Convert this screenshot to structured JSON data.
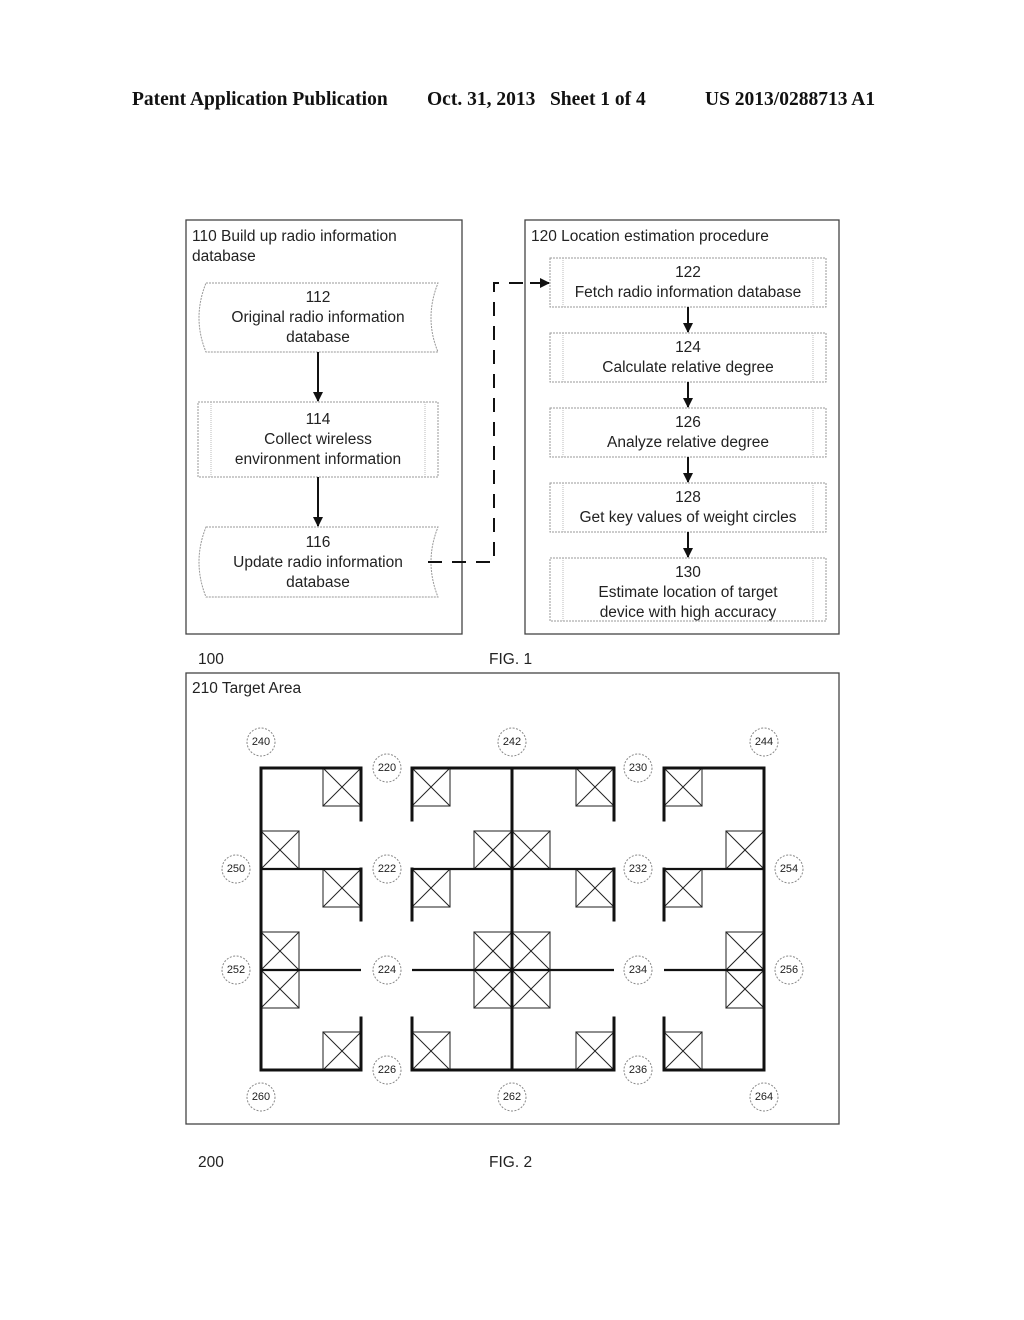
{
  "header": {
    "left": "Patent Application Publication",
    "date_sheet": "Oct. 31, 2013   Sheet 1 of 4",
    "number": "US 2013/0288713 A1"
  },
  "fig1": {
    "ref": "100",
    "caption": "FIG. 1",
    "group110": {
      "title_line1": "110 Build up radio information",
      "title_line2": "database",
      "steps": [
        {
          "num": "112",
          "lines": [
            "Original radio information",
            "database"
          ],
          "shape": "data-store"
        },
        {
          "num": "114",
          "lines": [
            "Collect wireless",
            "environment information"
          ],
          "shape": "process"
        },
        {
          "num": "116",
          "lines": [
            "Update radio information",
            "database"
          ],
          "shape": "data-store"
        }
      ]
    },
    "group120": {
      "title": "120 Location estimation procedure",
      "steps": [
        {
          "num": "122",
          "lines": [
            "Fetch radio information database"
          ]
        },
        {
          "num": "124",
          "lines": [
            "Calculate relative degree"
          ]
        },
        {
          "num": "126",
          "lines": [
            "Analyze relative degree"
          ]
        },
        {
          "num": "128",
          "lines": [
            "Get key values of weight circles"
          ]
        },
        {
          "num": "130",
          "lines": [
            "Estimate location of target",
            "device with high accuracy"
          ]
        }
      ]
    }
  },
  "fig2": {
    "ref": "200",
    "caption": "FIG. 2",
    "area_title": "210 Target Area",
    "corridor_labels": [
      "220",
      "222",
      "224",
      "226",
      "230",
      "232",
      "234",
      "236"
    ],
    "outer_labels": [
      "240",
      "242",
      "244",
      "250",
      "252",
      "254",
      "256",
      "260",
      "262",
      "264"
    ]
  }
}
